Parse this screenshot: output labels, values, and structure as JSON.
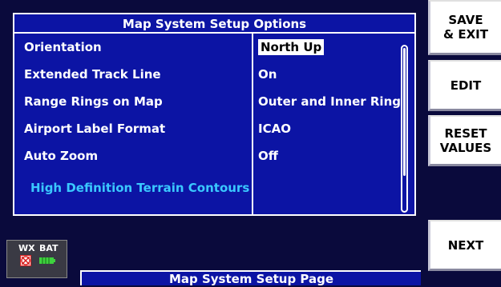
{
  "panel": {
    "title": "Map System Setup Options",
    "rows": [
      {
        "label": "Orientation",
        "value": "North Up"
      },
      {
        "label": "Extended Track Line",
        "value": "On"
      },
      {
        "label": "Range Rings on Map",
        "value": "Outer and Inner Ring"
      },
      {
        "label": "Airport Label Format",
        "value": "ICAO"
      },
      {
        "label": "Auto Zoom",
        "value": "Off"
      },
      {
        "label": "High Definition Terrain Contours",
        "value": ""
      }
    ]
  },
  "buttons": {
    "save": "SAVE\n& EXIT",
    "edit": "EDIT",
    "reset": "RESET\nVALUES",
    "next": "NEXT"
  },
  "status": {
    "wx": "WX",
    "bat": "BAT"
  },
  "footer": {
    "title": "Map System Setup Page"
  },
  "colors": {
    "background": "#0a0a3c",
    "panel": "#0c14a4",
    "link": "#3ac8ff",
    "battery": "#3ed23e",
    "wx_alert": "#d82020"
  }
}
